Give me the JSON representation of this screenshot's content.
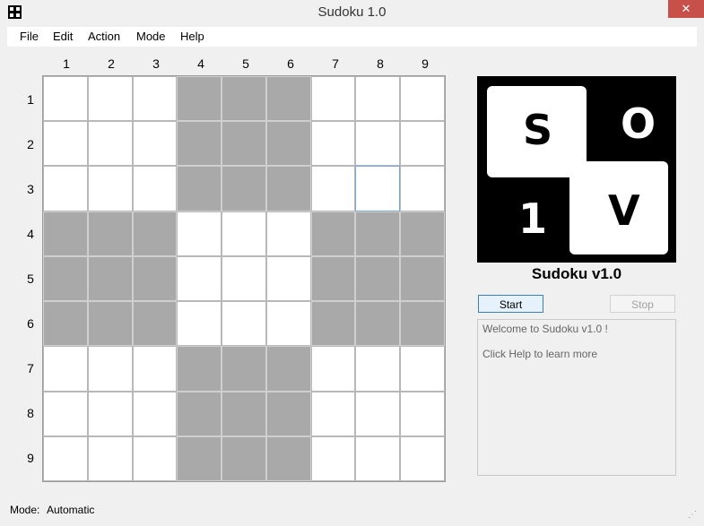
{
  "window": {
    "title": "Sudoku 1.0",
    "close_label": "✕"
  },
  "menu": [
    "File",
    "Edit",
    "Action",
    "Mode",
    "Help"
  ],
  "grid": {
    "column_labels": [
      "1",
      "2",
      "3",
      "4",
      "5",
      "6",
      "7",
      "8",
      "9"
    ],
    "row_labels": [
      "1",
      "2",
      "3",
      "4",
      "5",
      "6",
      "7",
      "8",
      "9"
    ],
    "selected_cell": "row 3, col 8"
  },
  "logo": {
    "letters": [
      "S",
      "O",
      "1",
      "V"
    ],
    "caption": "Sudoku v1.0"
  },
  "buttons": {
    "start": "Start",
    "stop": "Stop"
  },
  "log": {
    "lines": [
      "Welcome to Sudoku v1.0 !",
      "",
      "Click Help to learn more"
    ]
  },
  "status": {
    "label": "Mode:",
    "value": "Automatic"
  },
  "colors": {
    "shaded_cell": "#a9a9a9",
    "close_button": "#c7504a",
    "start_button_border": "#3c7fb1"
  }
}
